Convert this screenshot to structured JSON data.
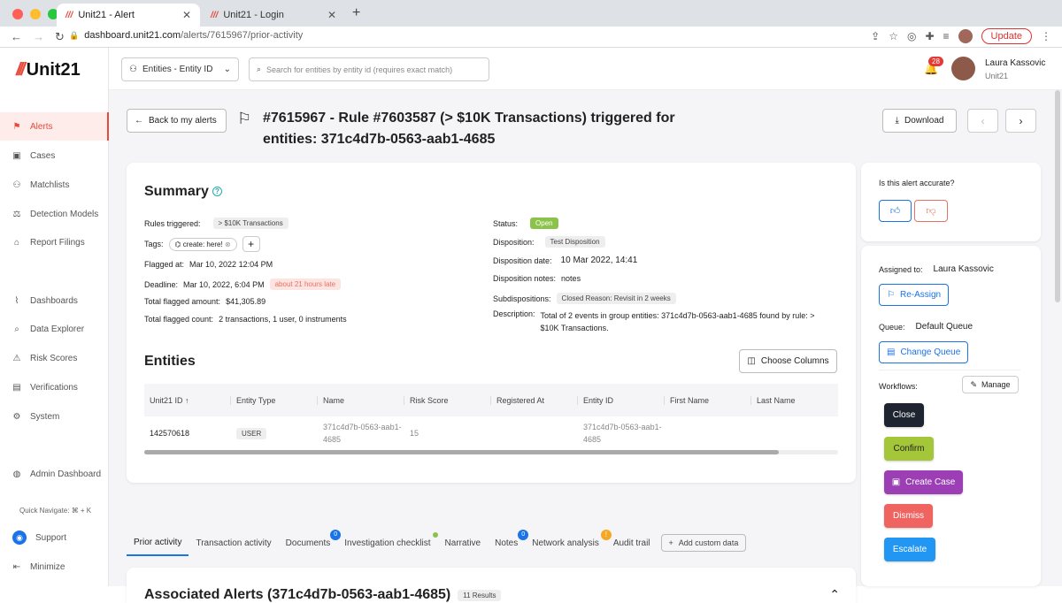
{
  "browser": {
    "tabs": [
      {
        "title": "Unit21 - Alert"
      },
      {
        "title": "Unit21 - Login"
      }
    ],
    "url_host": "dashboard.unit21.com",
    "url_path": "/alerts/7615967/prior-activity",
    "update_label": "Update"
  },
  "sidebar": {
    "brand": "Unit21",
    "items": [
      {
        "label": "Alerts",
        "icon": "flag-icon"
      },
      {
        "label": "Cases",
        "icon": "briefcase-icon"
      },
      {
        "label": "Matchlists",
        "icon": "person-plus-icon"
      },
      {
        "label": "Detection Models",
        "icon": "scale-icon"
      },
      {
        "label": "Report Filings",
        "icon": "bank-icon"
      },
      {
        "label": "Dashboards",
        "icon": "chart-icon"
      },
      {
        "label": "Data Explorer",
        "icon": "search-doc-icon"
      },
      {
        "label": "Risk Scores",
        "icon": "warning-icon"
      },
      {
        "label": "Verifications",
        "icon": "id-card-icon"
      },
      {
        "label": "System",
        "icon": "gear-icon"
      },
      {
        "label": "Admin Dashboard",
        "icon": "globe-icon"
      }
    ],
    "quick_navigate": "Quick Navigate: ⌘ + K",
    "support": "Support",
    "minimize": "Minimize"
  },
  "topbar": {
    "entity_dropdown": "Entities - Entity ID",
    "search_placeholder": "Search for entities by entity id (requires exact match)",
    "notifications": "28",
    "user_name": "Laura Kassovic",
    "user_org": "Unit21"
  },
  "header": {
    "back_label": "Back to my alerts",
    "title": "#7615967 - Rule #7603587 (> $10K Transactions) triggered for entities: 371c4d7b-0563-aab1-4685",
    "download_label": "Download"
  },
  "summary": {
    "title": "Summary",
    "rules_triggered_label": "Rules triggered:",
    "rules_triggered_value": "> $10K Transactions",
    "tags_label": "Tags:",
    "tag_value": "create: here!",
    "flagged_at_label": "Flagged at:",
    "flagged_at_value": "Mar 10, 2022 12:04 PM",
    "deadline_label": "Deadline:",
    "deadline_value": "Mar 10, 2022, 6:04 PM",
    "deadline_badge": "about 21 hours late",
    "total_amount_label": "Total flagged amount:",
    "total_amount_value": "$41,305.89",
    "total_count_label": "Total flagged count:",
    "total_count_value": "2 transactions, 1 user, 0 instruments",
    "status_label": "Status:",
    "status_value": "Open",
    "disposition_label": "Disposition:",
    "disposition_value": "Test Disposition",
    "disposition_date_label": "Disposition date:",
    "disposition_date_value": "10 Mar 2022, 14:41",
    "disposition_notes_label": "Disposition notes:",
    "disposition_notes_value": "notes",
    "subdispositions_label": "Subdispositions:",
    "subdispositions_value": "Closed Reason: Revisit in 2 weeks",
    "description_label": "Description:",
    "description_value": "Total of 2 events in group entities: 371c4d7b-0563-aab1-4685 found by rule: > $10K Transactions."
  },
  "entities": {
    "title": "Entities",
    "choose_columns": "Choose Columns",
    "columns": [
      "Unit21 ID ↑",
      "Entity Type",
      "Name",
      "Risk Score",
      "Registered At",
      "Entity ID",
      "First Name",
      "Last Name"
    ],
    "rows": [
      {
        "unit21_id": "142570618",
        "entity_type": "USER",
        "name": "371c4d7b-0563-aab1-4685",
        "risk_score": "15",
        "registered_at": "",
        "entity_id": "371c4d7b-0563-aab1-4685",
        "first_name": "",
        "last_name": ""
      }
    ]
  },
  "tabs": [
    {
      "label": "Prior activity"
    },
    {
      "label": "Transaction activity"
    },
    {
      "label": "Documents",
      "badge": "0"
    },
    {
      "label": "Investigation checklist"
    },
    {
      "label": "Narrative"
    },
    {
      "label": "Notes",
      "badge": "0"
    },
    {
      "label": "Network analysis",
      "badge": "!"
    },
    {
      "label": "Audit trail"
    }
  ],
  "add_custom_data": "Add custom data",
  "associated": {
    "title": "Associated Alerts (371c4d7b-0563-aab1-4685)",
    "count": "11 Results"
  },
  "right_panel": {
    "accurate_question": "Is this alert accurate?",
    "assigned_label": "Assigned to:",
    "assigned_value": "Laura Kassovic",
    "reassign": "Re-Assign",
    "queue_label": "Queue:",
    "queue_value": "Default Queue",
    "change_queue": "Change Queue",
    "workflows_label": "Workflows:",
    "manage": "Manage",
    "workflow_buttons": [
      {
        "label": "Close",
        "color": "#1f2530"
      },
      {
        "label": "Confirm",
        "color": "#a4c639"
      },
      {
        "label": "Create Case",
        "color": "#9c3fb5"
      },
      {
        "label": "Dismiss",
        "color": "#ef6461"
      },
      {
        "label": "Escalate",
        "color": "#2196f3"
      }
    ]
  }
}
